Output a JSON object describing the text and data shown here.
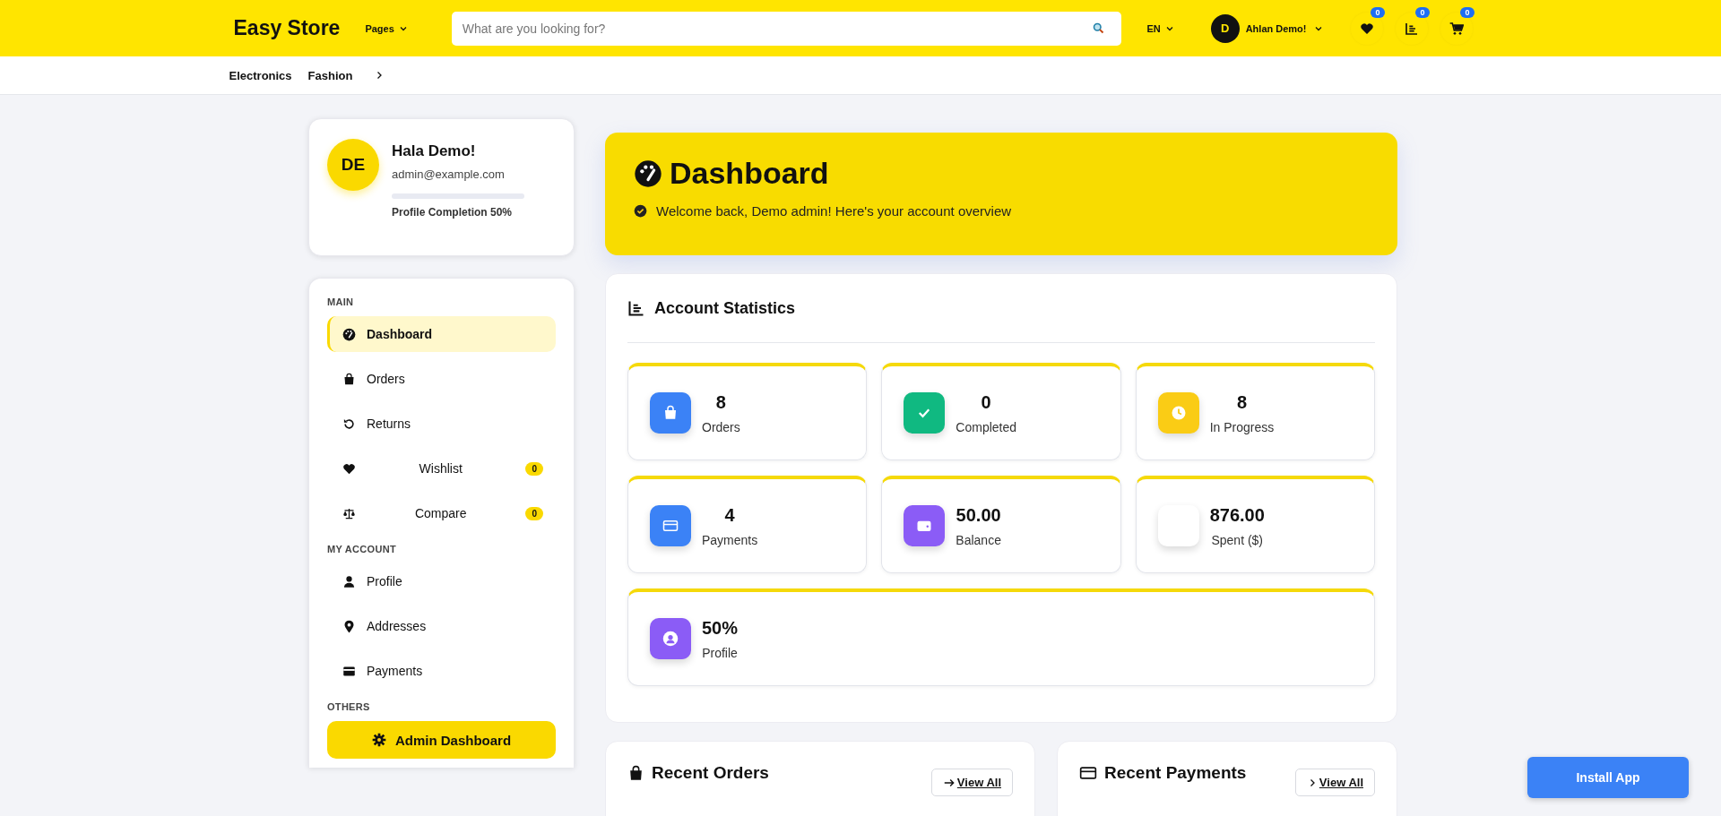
{
  "header": {
    "logo": "Easy Store",
    "pages_menu": "Pages",
    "search": {
      "placeholder": "What are you looking for?"
    },
    "language": "EN",
    "user": {
      "initial": "D",
      "name": "Ahlan Demo!"
    },
    "badges": [
      "0",
      "0",
      "0"
    ]
  },
  "categories": [
    "Electronics",
    "Fashion"
  ],
  "profile": {
    "initials": "DE",
    "greeting": "Hala Demo!",
    "email": "admin@example.com",
    "completion": "Profile Completion **50%**"
  },
  "sidebar": {
    "sections": [
      {
        "title": "MAIN",
        "items": [
          {
            "label": "Dashboard",
            "selected": true
          },
          {
            "label": "Orders",
            "selected": false
          },
          {
            "label": "Returns",
            "selected": false
          },
          {
            "label": "Wishlist",
            "selected": false,
            "badge": "0"
          },
          {
            "label": "Compare",
            "selected": false,
            "badge": "0"
          }
        ]
      },
      {
        "title": "MY ACCOUNT",
        "items": [
          {
            "label": "Profile",
            "selected": false
          },
          {
            "label": "Addresses",
            "selected": false
          },
          {
            "label": "Payments",
            "selected": false
          }
        ]
      },
      {
        "title": "OTHERS",
        "button": "Admin Dashboard"
      }
    ]
  },
  "banner": {
    "title": "Dashboard",
    "subtitle": "Welcome back, Demo admin! Here's your account overview"
  },
  "statistics": {
    "title": "Account Statistics",
    "cards": [
      {
        "value": "8",
        "label": "Orders",
        "color": "#3b82f6"
      },
      {
        "value": "0",
        "label": "Completed",
        "color": "#10b981"
      },
      {
        "value": "8",
        "label": "In Progress",
        "color": "#facc15"
      },
      {
        "value": "4",
        "label": "Payments",
        "color": "#3b82f6"
      },
      {
        "value": "50.00",
        "label": "Balance",
        "color": "#8b5cf6"
      },
      {
        "value": "876.00",
        "label": "Spent ($)",
        "color": "#ffffff"
      },
      {
        "value": "50%",
        "label": "Profile",
        "color": "#8b5cf6"
      }
    ]
  },
  "recent": [
    {
      "title": "Recent Orders",
      "link": "View All"
    },
    {
      "title": "Recent Payments",
      "link": "View All"
    }
  ],
  "install_button": "Install App"
}
